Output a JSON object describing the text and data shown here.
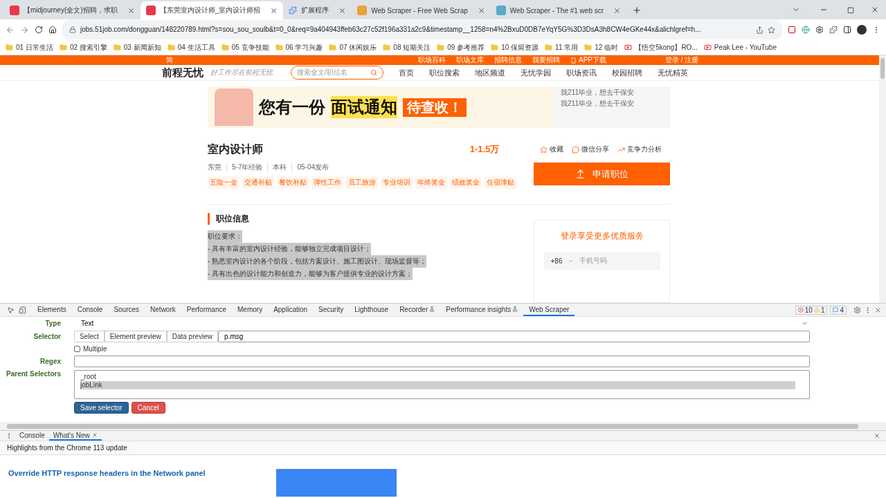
{
  "browser_tabs": [
    {
      "title": "【midjourney(全文)招聘，求职",
      "selected": false,
      "kind": "site"
    },
    {
      "title": "【东莞室内设计师_室内设计师招",
      "selected": true,
      "kind": "site"
    },
    {
      "title": "扩展程序",
      "selected": false,
      "kind": "extension"
    },
    {
      "title": "Web Scraper - Free Web Scrap",
      "selected": false,
      "kind": "scraper"
    },
    {
      "title": "Web Scraper - The #1 web scr",
      "selected": false,
      "kind": "globe"
    }
  ],
  "address_bar": {
    "url": "jobs.51job.com/dongguan/148220789.html?s=sou_sou_soulb&t=0_0&req=9a404943ffeb63c27c52f196a331a2c9&timestamp__1258=n4%2BxuD0DB7eYqY5G%3D3DsA3h8CW4eGKe44x&alichlgref=h..."
  },
  "bookmarks": [
    {
      "label": "01 日常生活",
      "kind": "folder"
    },
    {
      "label": "02 搜索引擎",
      "kind": "folder"
    },
    {
      "label": "03 新闻新知",
      "kind": "folder"
    },
    {
      "label": "04 生活工具",
      "kind": "folder"
    },
    {
      "label": "05 竞争技能",
      "kind": "folder"
    },
    {
      "label": "06 学习兴趣",
      "kind": "folder"
    },
    {
      "label": "07 休闲娱乐",
      "kind": "folder"
    },
    {
      "label": "08 短期关注",
      "kind": "folder"
    },
    {
      "label": "09 参考推荐",
      "kind": "folder"
    },
    {
      "label": "10 保留资源",
      "kind": "folder"
    },
    {
      "label": "11 常用",
      "kind": "folder"
    },
    {
      "label": "12 临时",
      "kind": "folder"
    },
    {
      "label": "【悟空5kong】RO...",
      "kind": "video"
    },
    {
      "label": "Peak Lee - YouTube",
      "kind": "video"
    }
  ],
  "site_topbar": {
    "lang": "简",
    "links": [
      {
        "label": "职场百科",
        "kind": "text"
      },
      {
        "label": "职场文库",
        "kind": "text"
      },
      {
        "label": "招聘信息",
        "kind": "text"
      },
      {
        "label": "我要招聘",
        "kind": "text"
      },
      {
        "label": "APP下载",
        "kind": "app"
      }
    ],
    "login": "登录 / 注册"
  },
  "site_nav": {
    "logo": "前程无忧",
    "slogan": "好工作尽在前程无忧",
    "search_placeholder": "搜索全文/职位名",
    "items": [
      "首页",
      "职位搜索",
      "地区频道",
      "无忧学园",
      "职场资讯",
      "校园招聘",
      "无忧精英"
    ]
  },
  "banner": {
    "lead": "您有一份",
    "highlight": "面试通知",
    "badge": "待查收！",
    "side_lines": [
      "我211毕业，想去干保安",
      "我211毕业，想去干保安"
    ]
  },
  "job": {
    "title": "室内设计师",
    "salary": "1-1.5万",
    "actions": [
      {
        "label": "收藏",
        "kind": "star"
      },
      {
        "label": "微信分享",
        "kind": "chat"
      },
      {
        "label": "竞争力分析",
        "kind": "chart"
      }
    ],
    "meta": [
      "东莞",
      "5-7年经验",
      "本科",
      "05-04发布"
    ],
    "tags": [
      "五险一金",
      "交通补贴",
      "餐饮补贴",
      "弹性工作",
      "员工旅游",
      "专业培训",
      "年终奖金",
      "绩效奖金",
      "住宿津贴"
    ],
    "apply": "申请职位",
    "section": "职位信息",
    "description": {
      "text_selected": true,
      "lines": [
        "职位要求：",
        "- 具有丰富的室内设计经验，能够独立完成项目设计；",
        "- 熟悉室内设计的各个阶段，包括方案设计、施工图设计、现场监督等；",
        "- 具有出色的设计能力和创造力，能够为客户提供专业的设计方案；"
      ]
    }
  },
  "login_card": {
    "title": "登录享受更多优质服务",
    "country_code": "+86",
    "phone_placeholder": "手机号码"
  },
  "devtools": {
    "tabs": [
      {
        "label": "Elements",
        "selected": false,
        "experimental": false
      },
      {
        "label": "Console",
        "selected": false,
        "experimental": false
      },
      {
        "label": "Sources",
        "selected": false,
        "experimental": false
      },
      {
        "label": "Network",
        "selected": false,
        "experimental": false
      },
      {
        "label": "Performance",
        "selected": false,
        "experimental": false
      },
      {
        "label": "Memory",
        "selected": false,
        "experimental": false
      },
      {
        "label": "Application",
        "selected": false,
        "experimental": false
      },
      {
        "label": "Security",
        "selected": false,
        "experimental": false
      },
      {
        "label": "Lighthouse",
        "selected": false,
        "experimental": false
      },
      {
        "label": "Recorder",
        "selected": false,
        "experimental": true
      },
      {
        "label": "Performance insights",
        "selected": false,
        "experimental": true
      },
      {
        "label": "Web Scraper",
        "selected": true,
        "experimental": false
      }
    ],
    "counts": {
      "errors": "10",
      "warnings": "1",
      "messages": "4"
    },
    "form": {
      "type_label": "Type",
      "type_value": "Text",
      "selector_label": "Selector",
      "selector_buttons": [
        "Select",
        "Element preview",
        "Data preview"
      ],
      "selector_value": "p.msg",
      "multiple_label": "Multiple",
      "multiple_checked": false,
      "regex_label": "Regex",
      "parent_label": "Parent Selectors",
      "parents": [
        {
          "label": "_root",
          "selected": false
        },
        {
          "label": "jobLink",
          "selected": true
        }
      ],
      "save": "Save selector",
      "cancel": "Cancel"
    }
  },
  "drawer": {
    "tabs": [
      {
        "label": "Console",
        "selected": false,
        "closable": false
      },
      {
        "label": "What's New",
        "selected": true,
        "closable": true
      }
    ],
    "subtitle": "Highlights from the Chrome 113 update",
    "headline": "Override HTTP response headers in the Network panel"
  }
}
